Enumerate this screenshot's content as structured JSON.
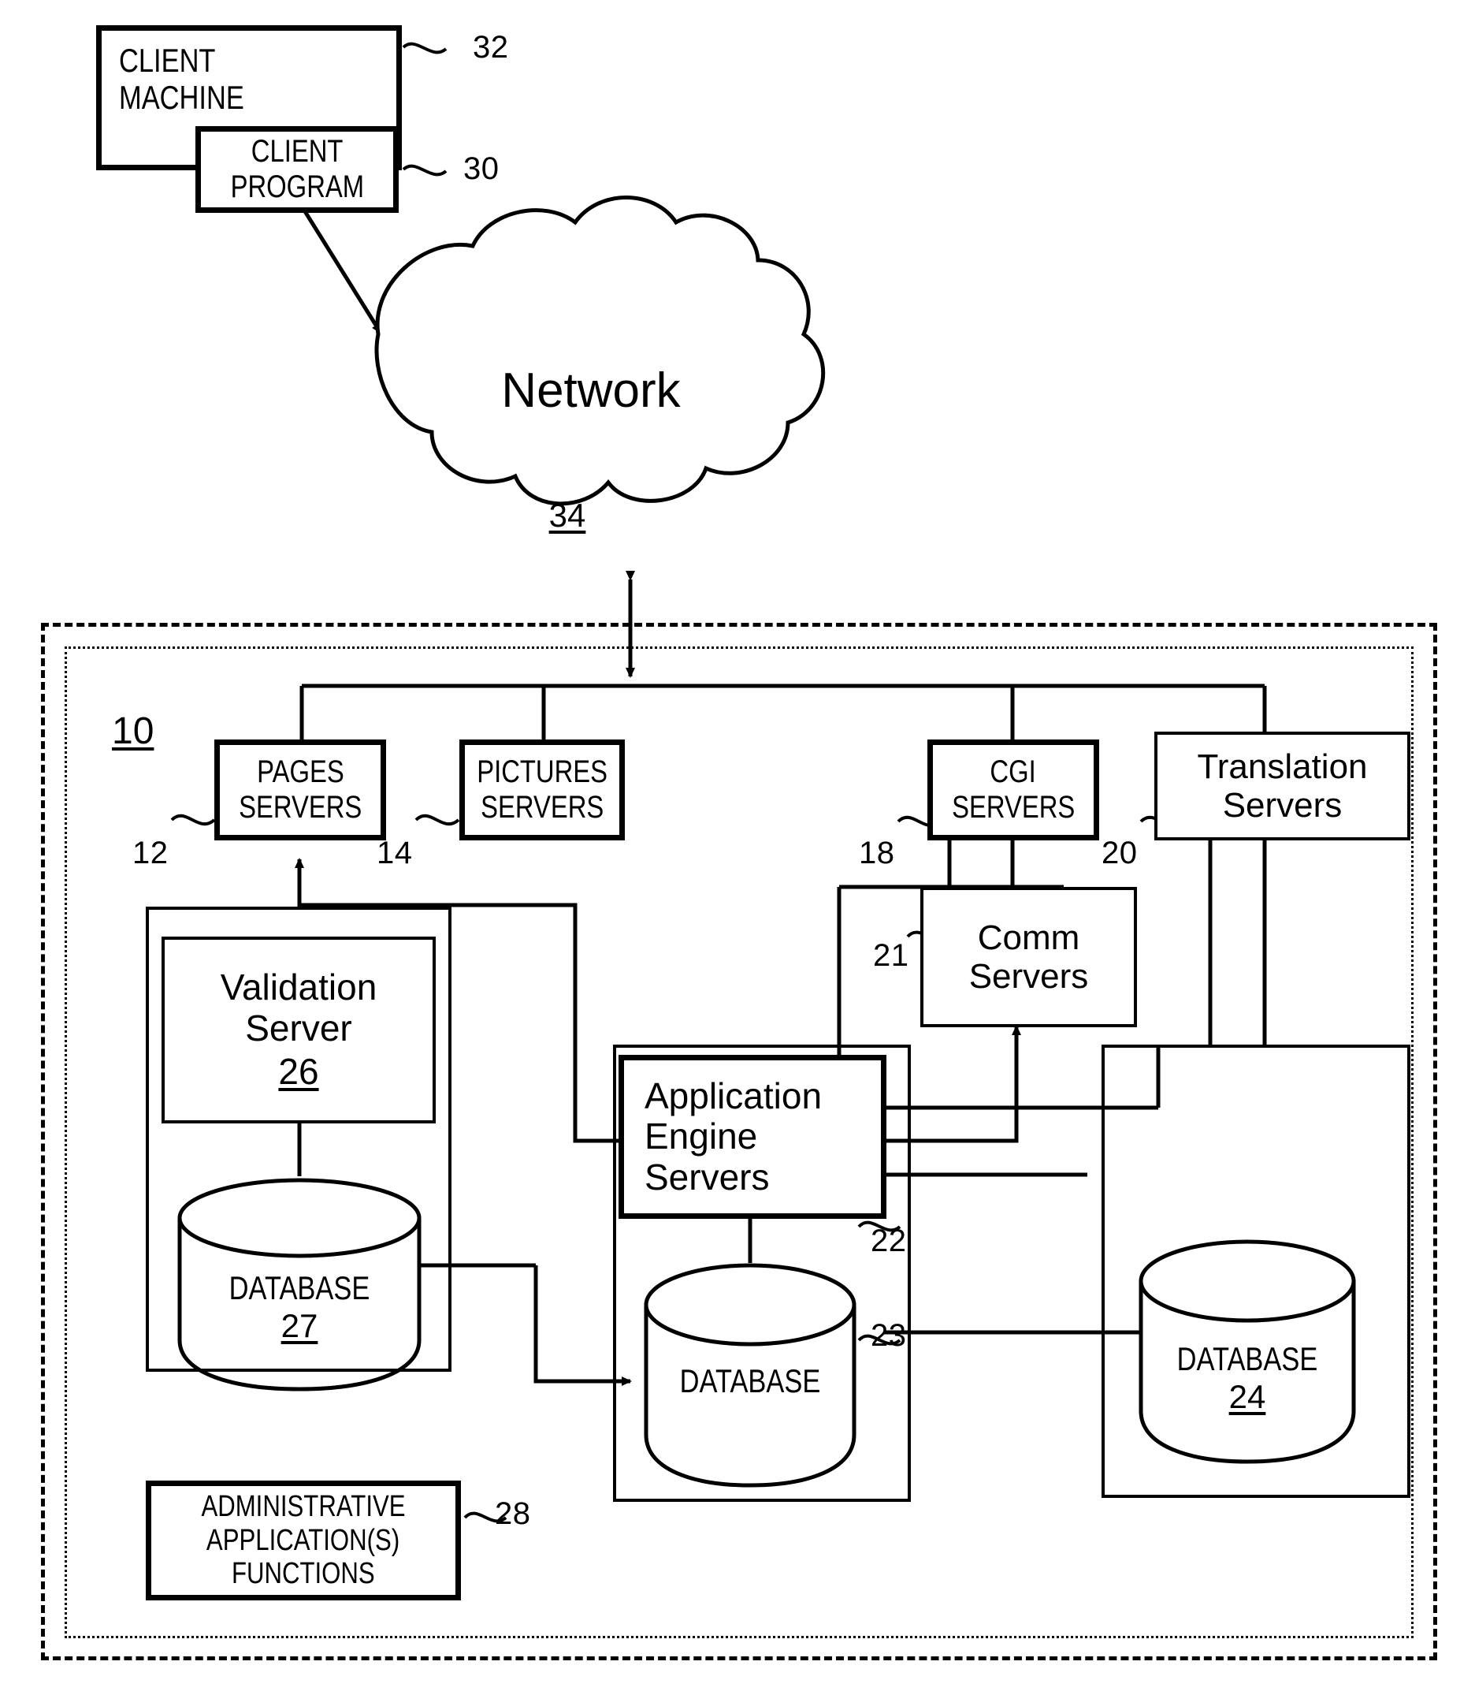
{
  "figure": {
    "type": "patent-system-architecture-diagram",
    "system_label": "10",
    "background": "#ffffff",
    "line_color": "#000000"
  },
  "client": {
    "machine_label": "CLIENT\nMACHINE",
    "machine_line1": "CLIENT",
    "machine_line2": "MACHINE",
    "machine_ref": "32",
    "program_line1": "CLIENT",
    "program_line2": "PROGRAM",
    "program_ref": "30"
  },
  "network": {
    "label": "Network",
    "ref": "34"
  },
  "system": {
    "ref": "10",
    "servers": [
      {
        "id": "pages",
        "line1": "PAGES",
        "line2": "SERVERS",
        "ref": "12",
        "style": "condensed-caps"
      },
      {
        "id": "pictures",
        "line1": "PICTURES",
        "line2": "SERVERS",
        "ref": "14",
        "style": "condensed-caps"
      },
      {
        "id": "cgi",
        "line1": "CGI",
        "line2": "SERVERS",
        "ref": "18",
        "style": "condensed-caps"
      },
      {
        "id": "translation",
        "line1": "Translation",
        "line2": "Servers",
        "ref": "20",
        "style": "sentence"
      },
      {
        "id": "comm",
        "line1": "Comm",
        "line2": "Servers",
        "ref": "21",
        "style": "sentence"
      }
    ],
    "validation": {
      "line1": "Validation",
      "line2": "Server",
      "ref": "26",
      "database_label": "DATABASE",
      "database_ref": "27"
    },
    "application": {
      "line1": "Application",
      "line2": "Engine",
      "line3": "Servers",
      "ref": "22",
      "database_label": "DATABASE",
      "database_ref": "23"
    },
    "translation_store": {
      "database_label": "DATABASE",
      "database_ref": "24"
    },
    "admin": {
      "line1": "ADMINISTRATIVE",
      "line2": "APPLICATION(S)",
      "line3": "FUNCTIONS",
      "ref": "28"
    }
  }
}
